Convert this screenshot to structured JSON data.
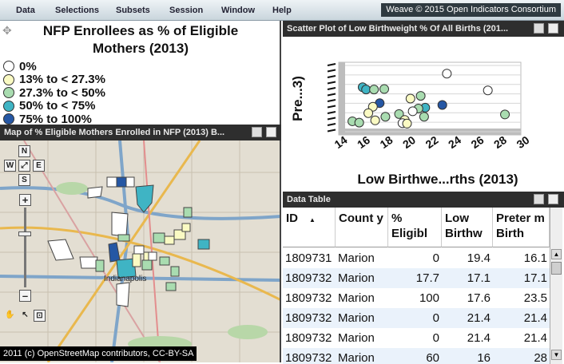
{
  "menu": [
    "Data",
    "Selections",
    "Subsets",
    "Session",
    "Window",
    "Help"
  ],
  "brand": "Weave © 2015 Open Indicators Consortium",
  "legend": {
    "title_line1": "NFP Enrollees as % of Eligible",
    "title_line2": "Mothers (2013)",
    "items": [
      {
        "label": "0%",
        "color": "#ffffff"
      },
      {
        "label": "13% to < 27.3%",
        "color": "#fafac3"
      },
      {
        "label": "27.3% to < 50%",
        "color": "#a9dcb0"
      },
      {
        "label": "50% to < 75%",
        "color": "#3fb4c4"
      },
      {
        "label": "75% to 100%",
        "color": "#2557a4"
      }
    ]
  },
  "map_panel": {
    "title": "Map of % Eligible Mothers Enrolled in NFP (2013) B...",
    "nav": {
      "n": "N",
      "w": "W",
      "e": "E",
      "s": "S"
    },
    "city_label": "Indianapolis",
    "attribution": "2011 (c) OpenStreetMap contributors, CC-BY-SA"
  },
  "scatter_panel": {
    "title": "Scatter Plot of Low Birthweight % Of All Births (201..."
  },
  "chart_data": {
    "type": "scatter",
    "title": "",
    "xlabel": "Low Birthwe...rths (2013)",
    "ylabel": "Pre...3)",
    "xlim": [
      14,
      30
    ],
    "x_ticks": [
      "14",
      "16",
      "18",
      "20",
      "22",
      "24",
      "26",
      "28",
      "30"
    ],
    "ylim": [
      10,
      26
    ],
    "grid": true,
    "points": [
      {
        "x": 16.1,
        "y": 20.5,
        "color": "#3fb4c4"
      },
      {
        "x": 16.4,
        "y": 20.0,
        "color": "#3fb4c4"
      },
      {
        "x": 17.1,
        "y": 20.0,
        "color": "#a9dcb0"
      },
      {
        "x": 18.0,
        "y": 20.1,
        "color": "#a9dcb0"
      },
      {
        "x": 23.5,
        "y": 23.5,
        "color": "#ffffff"
      },
      {
        "x": 27.1,
        "y": 19.8,
        "color": "#ffffff"
      },
      {
        "x": 21.2,
        "y": 18.6,
        "color": "#a9dcb0"
      },
      {
        "x": 20.3,
        "y": 18.0,
        "color": "#fafac3"
      },
      {
        "x": 17.6,
        "y": 17.0,
        "color": "#2557a4"
      },
      {
        "x": 23.1,
        "y": 16.6,
        "color": "#2557a4"
      },
      {
        "x": 21.6,
        "y": 16.0,
        "color": "#3fb4c4"
      },
      {
        "x": 17.0,
        "y": 16.2,
        "color": "#fafac3"
      },
      {
        "x": 21.0,
        "y": 15.8,
        "color": "#a9dcb0"
      },
      {
        "x": 20.5,
        "y": 15.2,
        "color": "#ffffff"
      },
      {
        "x": 19.3,
        "y": 14.6,
        "color": "#a9dcb0"
      },
      {
        "x": 16.6,
        "y": 14.8,
        "color": "#fafac3"
      },
      {
        "x": 18.1,
        "y": 14.0,
        "color": "#a9dcb0"
      },
      {
        "x": 21.5,
        "y": 14.0,
        "color": "#a9dcb0"
      },
      {
        "x": 15.2,
        "y": 13.0,
        "color": "#a9dcb0"
      },
      {
        "x": 15.8,
        "y": 12.7,
        "color": "#a9dcb0"
      },
      {
        "x": 17.2,
        "y": 13.2,
        "color": "#fafac3"
      },
      {
        "x": 19.8,
        "y": 13.3,
        "color": "#fafac3"
      },
      {
        "x": 19.6,
        "y": 12.6,
        "color": "#ffffff"
      },
      {
        "x": 20.0,
        "y": 12.5,
        "color": "#fafac3"
      },
      {
        "x": 28.6,
        "y": 14.5,
        "color": "#a9dcb0"
      }
    ]
  },
  "table_panel": {
    "title": "Data Table",
    "columns": [
      "ID",
      "Count y",
      "% Eligibl",
      "Low Birthw",
      "Preter m Birth"
    ],
    "rows": [
      [
        "1809731",
        "Marion",
        "0",
        "19.4",
        "16.1"
      ],
      [
        "1809732",
        "Marion",
        "17.7",
        "17.1",
        "17.1"
      ],
      [
        "1809732",
        "Marion",
        "100",
        "17.6",
        "23.5"
      ],
      [
        "1809732",
        "Marion",
        "0",
        "21.4",
        "21.4"
      ],
      [
        "1809732",
        "Marion",
        "0",
        "21.4",
        "21.4"
      ],
      [
        "1809732",
        "Marion",
        "60",
        "16",
        "28"
      ]
    ]
  }
}
